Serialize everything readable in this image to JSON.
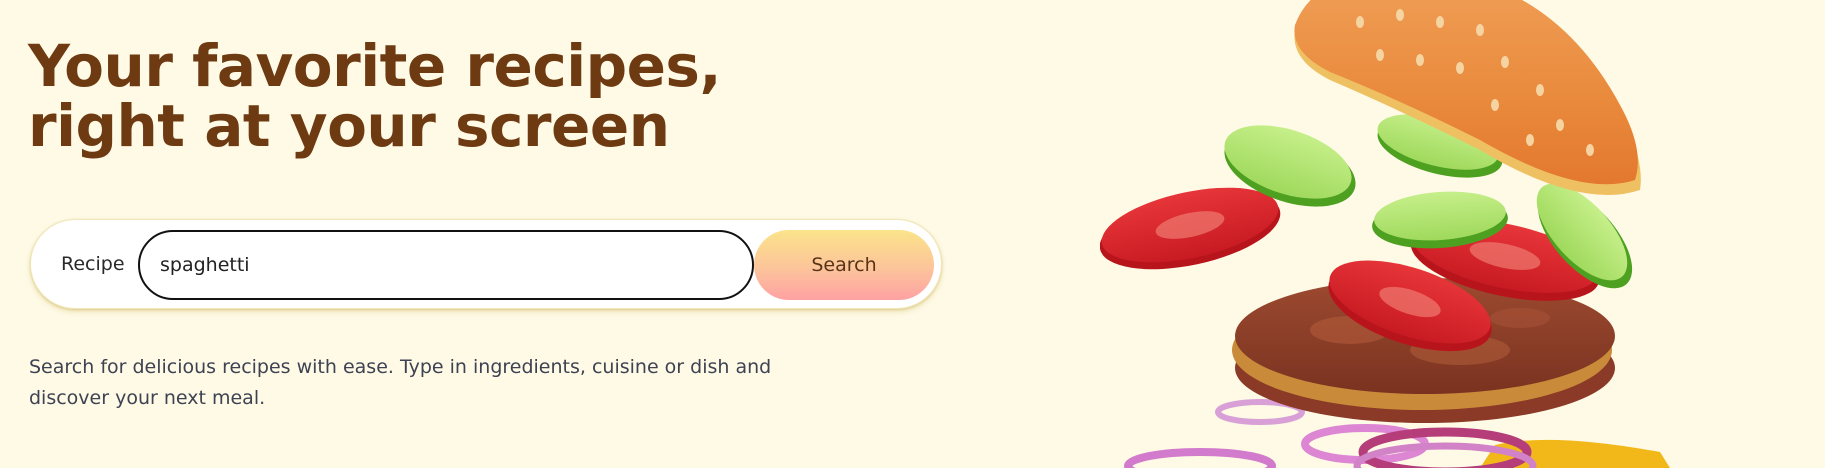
{
  "hero": {
    "title": "Your favorite recipes, right at your screen",
    "description": "Search for delicious recipes with ease. Type in ingredients, cuisine or dish and discover your next meal."
  },
  "search": {
    "label": "Recipe",
    "value": "spaghetti",
    "button_label": "Search"
  },
  "colors": {
    "background": "#fefae6",
    "title": "#6e3a12",
    "button_gradient": [
      "#fbe48a",
      "#fea1a3"
    ],
    "button_text": "#5a3418"
  },
  "illustration": {
    "icon": "burger-illustration"
  }
}
